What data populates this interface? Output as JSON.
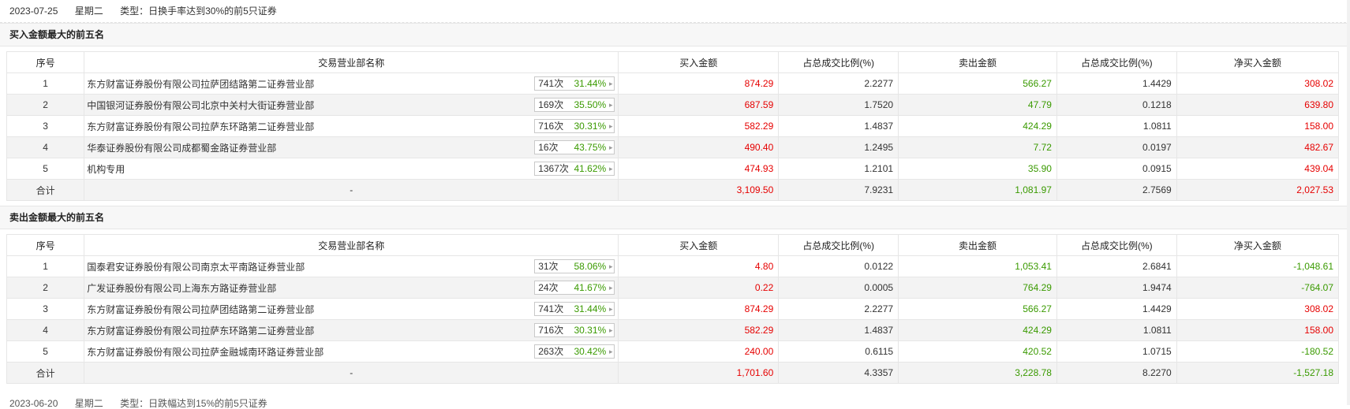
{
  "info": {
    "date": "2023-07-25",
    "weekday": "星期二",
    "type": "类型：日换手率达到30%的前5只证券"
  },
  "headers": [
    "序号",
    "交易营业部名称",
    "买入金额",
    "占总成交比例(%)",
    "卖出金额",
    "占总成交比例(%)",
    "净买入金额"
  ],
  "sections": [
    {
      "title": "买入金额最大的前五名",
      "rows": [
        {
          "no": "1",
          "name": "东方财富证券股份有限公司拉萨团结路第二证券营业部",
          "count": "741次",
          "pct": "31.44%",
          "buy": "874.29",
          "buy_ratio": "2.2277",
          "sell": "566.27",
          "sell_ratio": "1.4429",
          "net": "308.02"
        },
        {
          "no": "2",
          "name": "中国银河证券股份有限公司北京中关村大街证券营业部",
          "count": "169次",
          "pct": "35.50%",
          "buy": "687.59",
          "buy_ratio": "1.7520",
          "sell": "47.79",
          "sell_ratio": "0.1218",
          "net": "639.80"
        },
        {
          "no": "3",
          "name": "东方财富证券股份有限公司拉萨东环路第二证券营业部",
          "count": "716次",
          "pct": "30.31%",
          "buy": "582.29",
          "buy_ratio": "1.4837",
          "sell": "424.29",
          "sell_ratio": "1.0811",
          "net": "158.00"
        },
        {
          "no": "4",
          "name": "华泰证券股份有限公司成都蜀金路证券营业部",
          "count": "16次",
          "pct": "43.75%",
          "buy": "490.40",
          "buy_ratio": "1.2495",
          "sell": "7.72",
          "sell_ratio": "0.0197",
          "net": "482.67"
        },
        {
          "no": "5",
          "name": "机构专用",
          "count": "1367次",
          "pct": "41.62%",
          "buy": "474.93",
          "buy_ratio": "1.2101",
          "sell": "35.90",
          "sell_ratio": "0.0915",
          "net": "439.04"
        }
      ],
      "total": {
        "label": "合计",
        "name": "-",
        "buy": "3,109.50",
        "buy_ratio": "7.9231",
        "sell": "1,081.97",
        "sell_ratio": "2.7569",
        "net": "2,027.53"
      }
    },
    {
      "title": "卖出金额最大的前五名",
      "rows": [
        {
          "no": "1",
          "name": "国泰君安证券股份有限公司南京太平南路证券营业部",
          "count": "31次",
          "pct": "58.06%",
          "buy": "4.80",
          "buy_ratio": "0.0122",
          "sell": "1,053.41",
          "sell_ratio": "2.6841",
          "net": "-1,048.61"
        },
        {
          "no": "2",
          "name": "广发证券股份有限公司上海东方路证券营业部",
          "count": "24次",
          "pct": "41.67%",
          "buy": "0.22",
          "buy_ratio": "0.0005",
          "sell": "764.29",
          "sell_ratio": "1.9474",
          "net": "-764.07"
        },
        {
          "no": "3",
          "name": "东方财富证券股份有限公司拉萨团结路第二证券营业部",
          "count": "741次",
          "pct": "31.44%",
          "buy": "874.29",
          "buy_ratio": "2.2277",
          "sell": "566.27",
          "sell_ratio": "1.4429",
          "net": "308.02"
        },
        {
          "no": "4",
          "name": "东方财富证券股份有限公司拉萨东环路第二证券营业部",
          "count": "716次",
          "pct": "30.31%",
          "buy": "582.29",
          "buy_ratio": "1.4837",
          "sell": "424.29",
          "sell_ratio": "1.0811",
          "net": "158.00"
        },
        {
          "no": "5",
          "name": "东方财富证券股份有限公司拉萨金融城南环路证券营业部",
          "count": "263次",
          "pct": "30.42%",
          "buy": "240.00",
          "buy_ratio": "0.6115",
          "sell": "420.52",
          "sell_ratio": "1.0715",
          "net": "-180.52"
        }
      ],
      "total": {
        "label": "合计",
        "name": "-",
        "buy": "1,701.60",
        "buy_ratio": "4.3357",
        "sell": "3,228.78",
        "sell_ratio": "8.2270",
        "net": "-1,527.18"
      }
    }
  ],
  "next_info": {
    "date": "2023-06-20",
    "weekday": "星期二",
    "type": "类型：日跌幅达到15%的前5只证券"
  },
  "colors": {
    "up": "#e60000",
    "down": "#3a9a00"
  },
  "icons": {
    "badge_arrow": "chevron-right-icon"
  }
}
